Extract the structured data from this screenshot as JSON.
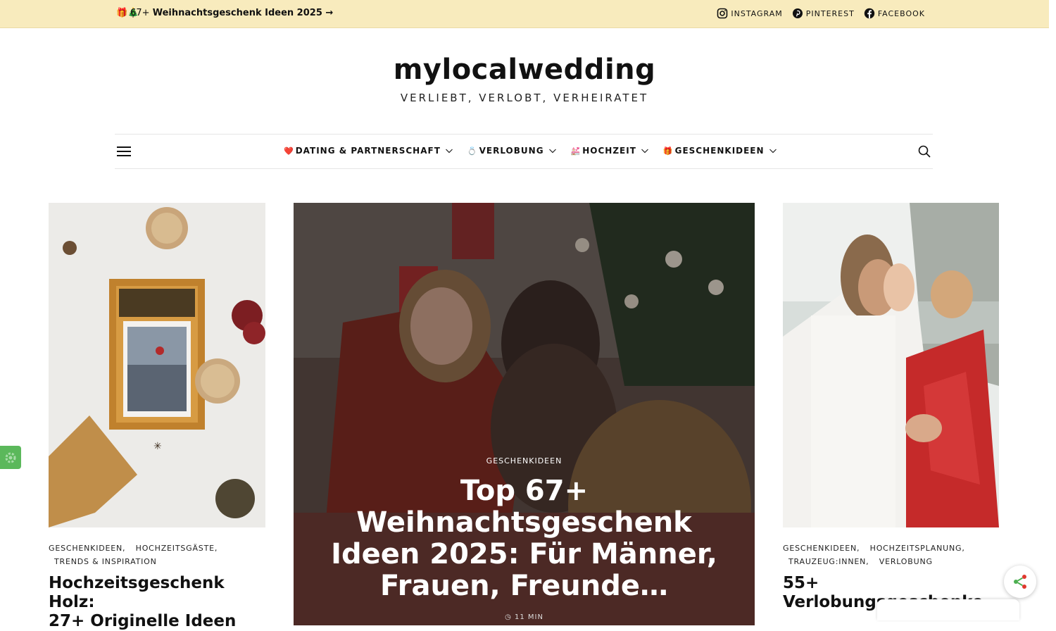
{
  "topbar": {
    "promo_emoji": "🎁🎄",
    "promo_count": "67+",
    "promo_text": "Weihnachtsgeschenk Ideen 2025 →",
    "social": [
      {
        "label": "INSTAGRAM",
        "icon": "instagram-icon"
      },
      {
        "label": "PINTEREST",
        "icon": "pinterest-icon"
      },
      {
        "label": "FACEBOOK",
        "icon": "facebook-icon"
      }
    ]
  },
  "brand": {
    "title": "mylocalwedding",
    "tagline": "VERLIEBT, VERLOBT, VERHEIRATET"
  },
  "nav": {
    "items": [
      {
        "emoji": "❤️",
        "label": "DATING & PARTNERSCHAFT"
      },
      {
        "emoji": "💍",
        "label": "VERLOBUNG"
      },
      {
        "emoji": "💒",
        "label": "HOCHZEIT"
      },
      {
        "emoji": "🎁",
        "label": "GESCHENKIDEEN"
      }
    ]
  },
  "posts": {
    "left": {
      "categories": [
        "GESCHENKIDEEN,",
        "HOCHZEITSGÄSTE,",
        "TRENDS & INSPIRATION"
      ],
      "title_line1": "Hochzeitsgeschenk Holz:",
      "title_line2": "27+ Originelle Ideen"
    },
    "featured": {
      "category": "GESCHENKIDEEN",
      "title": "Top 67+ Weihnachtsgeschenk Ideen 2025: Für Männer, Frauen, Freunde…",
      "meta": "11 MIN"
    },
    "right": {
      "categories": [
        "GESCHENKIDEEN,",
        "HOCHZEITSPLANUNG,",
        "TRAUZEUG:INNEN,",
        "VERLOBUNG"
      ],
      "title_line1": "55+",
      "title_line2": "Verlobungsgeschenke"
    }
  },
  "colors": {
    "topbar_bg": "#f8ebbd",
    "share_accent": "#e0392f",
    "badge": "#5bb85b"
  }
}
